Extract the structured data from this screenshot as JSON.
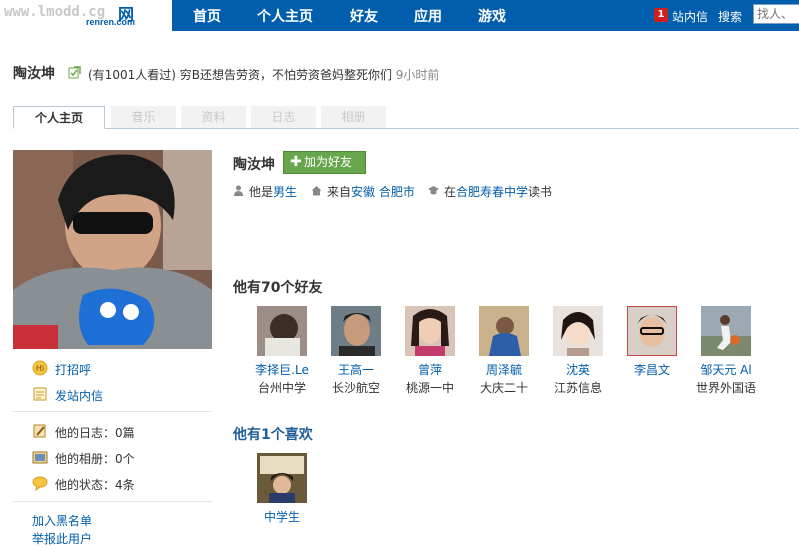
{
  "topbar": {
    "logo_watermark": "www.lmodd.cg",
    "logo_brand": "renren.com",
    "logo_net": "网",
    "nav": [
      "首页",
      "个人主页",
      "好友",
      "应用",
      "游戏"
    ],
    "msg_count": "1",
    "msg_label": "站内信",
    "search_label": "搜索",
    "search_placeholder": "找人、"
  },
  "header": {
    "name": "陶汝坤",
    "status_prefix": "(有1001人看过)",
    "status_text": "穷B还想告劳资，不怕劳资爸妈整死你们",
    "status_time": "9小时前"
  },
  "tabs": [
    "个人主页",
    "音乐",
    "资料",
    "日志",
    "相册"
  ],
  "left": {
    "greet": "打招呼",
    "send_msg": "发站内信",
    "stats": [
      "他的日志：0篇",
      "他的相册：0个",
      "他的状态：4条"
    ],
    "blacklist": "加入黑名单",
    "more": "举报此用户"
  },
  "profile": {
    "name": "陶汝坤",
    "add_friend": "加为好友",
    "gender_prefix": "他是",
    "gender": "男生",
    "from_prefix": "来自",
    "province": "安徽",
    "city": "合肥市",
    "school_prefix": "在",
    "school": "合肥寿春中学",
    "school_suffix": "读书"
  },
  "friends": {
    "title": "他有70个好友",
    "items": [
      {
        "name": "李择巨.Le",
        "school": "台州中学"
      },
      {
        "name": "王高一",
        "school": "长沙航空"
      },
      {
        "name": "曾萍",
        "school": "桃源一中"
      },
      {
        "name": "周泽毓",
        "school": "大庆二十"
      },
      {
        "name": "沈英",
        "school": "江苏信息"
      },
      {
        "name": "李昌文",
        "school": ""
      },
      {
        "name": "邹天元 Al",
        "school": "世界外国语"
      }
    ]
  },
  "likes": {
    "title": "他有1个喜欢",
    "items": [
      {
        "name": "中学生"
      }
    ]
  },
  "colors": {
    "nav_bg": "#005eac",
    "link": "#005eac",
    "add_btn": "#67a64c",
    "badge": "#d21e1e"
  }
}
